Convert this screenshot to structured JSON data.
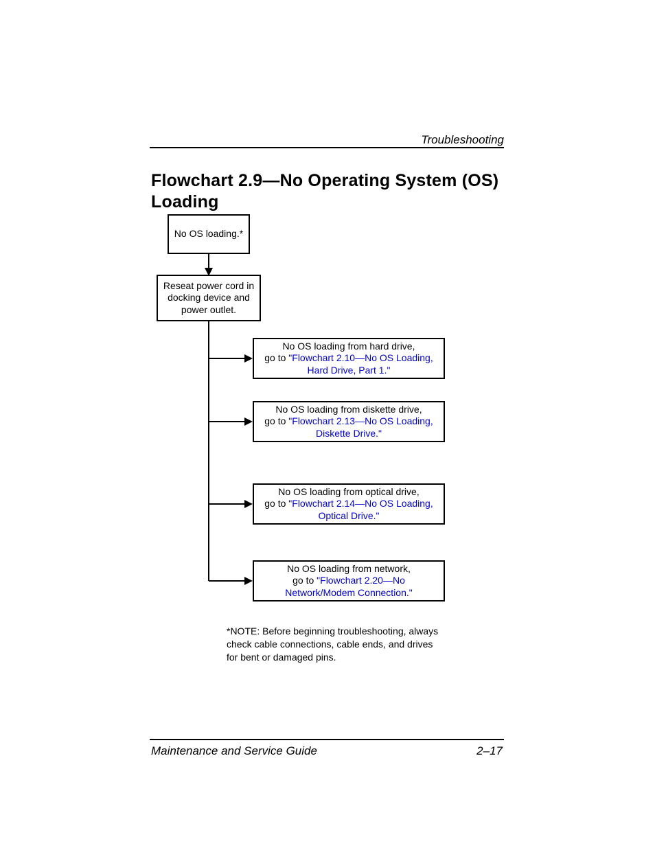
{
  "header": {
    "section": "Troubleshooting"
  },
  "title": "Flowchart 2.9—No Operating System (OS) Loading",
  "flow": {
    "start": "No OS loading.*",
    "step": "Reseat power cord in docking device and power outlet.",
    "branches": [
      {
        "pre": "No OS loading from hard drive,",
        "goto": "go to ",
        "link": "\"Flowchart 2.10—No OS Loading, Hard Drive, Part 1.\""
      },
      {
        "pre": "No OS loading from diskette drive,",
        "goto": "go to ",
        "link": "\"Flowchart 2.13—No OS Loading, Diskette Drive.\""
      },
      {
        "pre": "No OS loading from optical drive,",
        "goto": "go to ",
        "link": "\"Flowchart 2.14—No OS Loading, Optical Drive.\""
      },
      {
        "pre": "No OS loading from network,",
        "goto": "go to ",
        "link": "\"Flowchart 2.20—No Network/Modem Connection.\""
      }
    ]
  },
  "note": "*NOTE: Before beginning troubleshooting, always check cable connections, cable ends, and drives for bent or damaged pins.",
  "footer": {
    "left": "Maintenance and Service Guide",
    "right": "2–17"
  }
}
